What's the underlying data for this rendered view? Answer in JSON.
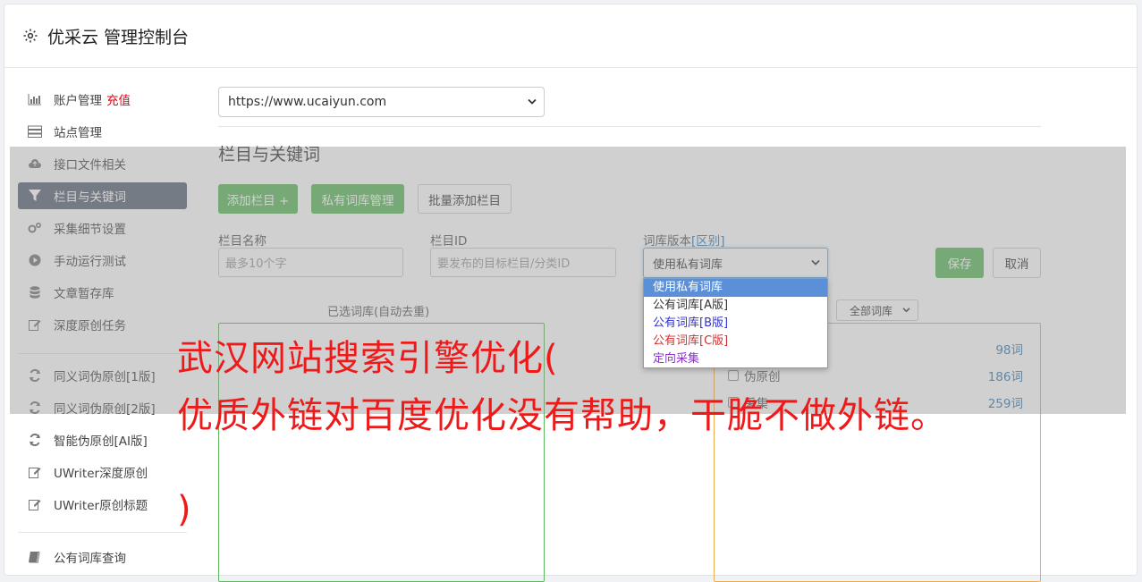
{
  "header": {
    "title": "优采云 管理控制台",
    "icon": "gear-icon"
  },
  "sidebar": {
    "items": [
      {
        "label": "账户管理",
        "badge": "充值",
        "icon": "bar-chart-icon"
      },
      {
        "label": "站点管理",
        "icon": "server-icon"
      },
      {
        "label": "接口文件相关",
        "icon": "cloud-upload-icon"
      },
      {
        "label": "栏目与关键词",
        "icon": "filter-icon",
        "active": true
      },
      {
        "label": "采集细节设置",
        "icon": "cogs-icon"
      },
      {
        "label": "手动运行测试",
        "icon": "play-circle-icon"
      },
      {
        "label": "文章暂存库",
        "icon": "database-icon"
      },
      {
        "label": "深度原创任务",
        "icon": "edit-icon"
      },
      {
        "label": "同义词伪原创[1版]",
        "icon": "refresh-icon"
      },
      {
        "label": "同义词伪原创[2版]",
        "icon": "refresh-icon"
      },
      {
        "label": "智能伪原创[AI版]",
        "icon": "refresh-icon"
      },
      {
        "label": "UWriter深度原创",
        "icon": "edit-icon"
      },
      {
        "label": "UWriter原创标题",
        "icon": "edit-icon"
      },
      {
        "label": "公有词库查询",
        "icon": "book-icon"
      }
    ]
  },
  "main": {
    "site_select": "https://www.ucaiyun.com",
    "section_title": "栏目与关键词",
    "buttons": {
      "add_column": "添加栏目 +",
      "private_lib": "私有词库管理",
      "batch_add": "批量添加栏目",
      "save": "保存",
      "cancel": "取消"
    },
    "form": {
      "name_label": "栏目名称",
      "name_placeholder": "最多10个字",
      "id_label": "栏目ID",
      "id_placeholder": "要发布的目标栏目/分类ID",
      "version_label": "词库版本",
      "version_link": "[区别]",
      "version_value": "使用私有词库",
      "version_options": [
        {
          "label": "使用私有词库",
          "color": "#ffffff"
        },
        {
          "label": "公有词库[A版]",
          "color": "#333333"
        },
        {
          "label": "公有词库[B版]",
          "color": "#3333cc"
        },
        {
          "label": "公有词库[C版]",
          "color": "#cc3333"
        },
        {
          "label": "定向采集",
          "color": "#8833cc"
        }
      ]
    },
    "selected_lib_caption": "已选词库(自动去重)",
    "all_lib_select": "全部词库",
    "lib_rows": [
      {
        "label": "",
        "count": "98词"
      },
      {
        "label": "伪原创",
        "count": "186词"
      },
      {
        "label": "采集",
        "count": "259词"
      }
    ]
  },
  "overlay_text": {
    "line1": "武汉网站搜索引擎优化(",
    "line2": "优质外链对百度优化没有帮助，干脆不做外链。",
    "line3": ")"
  }
}
